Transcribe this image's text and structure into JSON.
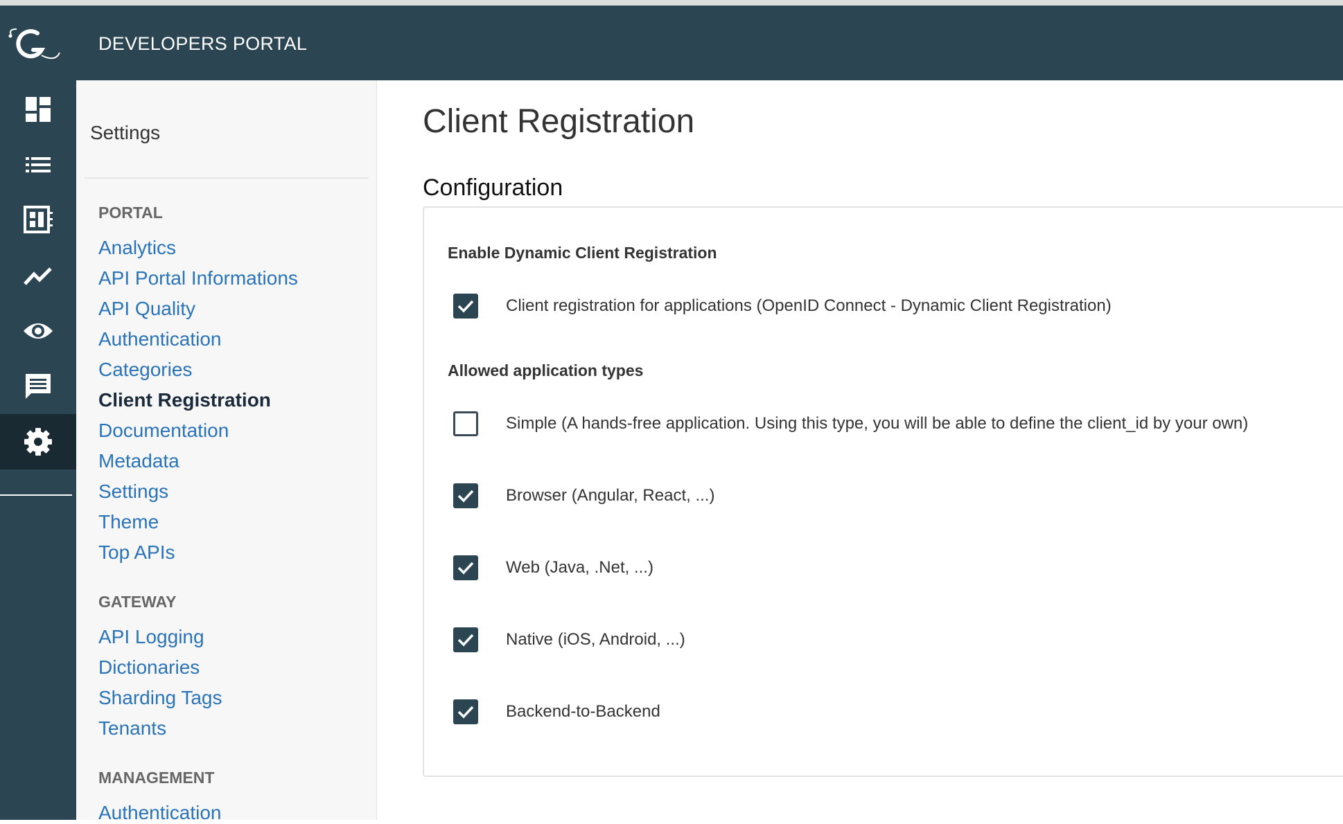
{
  "header": {
    "title": "DEVELOPERS PORTAL"
  },
  "iconbar": {
    "items": [
      {
        "icon": "dashboard-icon"
      },
      {
        "icon": "list-icon"
      },
      {
        "icon": "apis-icon"
      },
      {
        "icon": "analytics-icon"
      },
      {
        "icon": "eye-icon"
      },
      {
        "icon": "messages-icon"
      },
      {
        "icon": "gear-icon",
        "active": true
      }
    ]
  },
  "settings": {
    "title": "Settings",
    "groups": [
      {
        "title": "PORTAL",
        "items": [
          "Analytics",
          "API Portal Informations",
          "API Quality",
          "Authentication",
          "Categories",
          "Client Registration",
          "Documentation",
          "Metadata",
          "Settings",
          "Theme",
          "Top APIs"
        ]
      },
      {
        "title": "GATEWAY",
        "items": [
          "API Logging",
          "Dictionaries",
          "Sharding Tags",
          "Tenants"
        ]
      },
      {
        "title": "MANAGEMENT",
        "items": [
          "Authentication"
        ]
      }
    ],
    "current": "Client Registration"
  },
  "main": {
    "title": "Client Registration",
    "config_title": "Configuration",
    "enable_section": {
      "label": "Enable Dynamic Client Registration",
      "option": {
        "label": "Client registration for applications (OpenID Connect - Dynamic Client Registration)",
        "checked": true
      }
    },
    "types_section": {
      "label": "Allowed application types",
      "options": [
        {
          "label": "Simple (A hands-free application. Using this type, you will be able to define the client_id by your own)",
          "checked": false
        },
        {
          "label": "Browser (Angular, React, ...)",
          "checked": true
        },
        {
          "label": "Web (Java, .Net, ...)",
          "checked": true
        },
        {
          "label": "Native (iOS, Android, ...)",
          "checked": true
        },
        {
          "label": "Backend-to-Backend",
          "checked": true
        }
      ]
    }
  },
  "colors": {
    "header_bg": "#2b4552",
    "link": "#2a73b8",
    "checkbox": "#2b4552"
  }
}
